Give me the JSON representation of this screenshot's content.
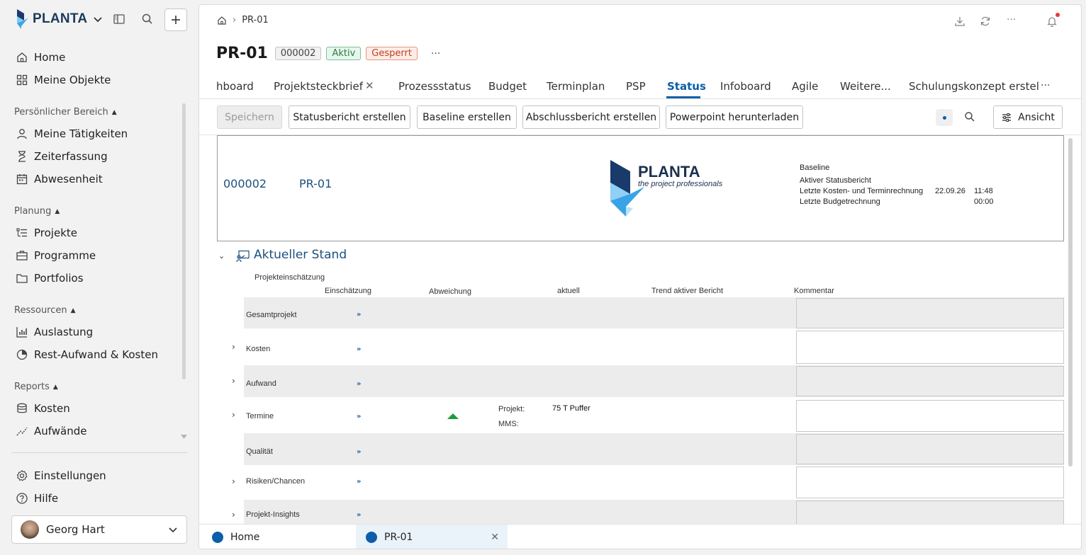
{
  "brand": {
    "name": "PLANTA"
  },
  "sidebar": {
    "top_items": [
      {
        "label": "Home",
        "icon": "home-icon"
      },
      {
        "label": "Meine Objekte",
        "icon": "grid-icon"
      }
    ],
    "sections": [
      {
        "title": "Persönlicher Bereich",
        "items": [
          {
            "label": "Meine Tätigkeiten",
            "icon": "user-icon"
          },
          {
            "label": "Zeiterfassung",
            "icon": "hourglass-icon"
          },
          {
            "label": "Abwesenheit",
            "icon": "calendar-icon"
          }
        ]
      },
      {
        "title": "Planung",
        "items": [
          {
            "label": "Projekte",
            "icon": "list-tree-icon"
          },
          {
            "label": "Programme",
            "icon": "briefcase-icon"
          },
          {
            "label": "Portfolios",
            "icon": "folder-icon"
          }
        ]
      },
      {
        "title": "Ressourcen",
        "items": [
          {
            "label": "Auslastung",
            "icon": "bar-chart-icon"
          },
          {
            "label": "Rest-Aufwand & Kosten",
            "icon": "pie-chart-icon"
          }
        ]
      },
      {
        "title": "Reports",
        "items": [
          {
            "label": "Kosten",
            "icon": "coins-icon"
          },
          {
            "label": "Aufwände",
            "icon": "trend-icon"
          }
        ]
      }
    ],
    "bottom_items": [
      {
        "label": "Einstellungen",
        "icon": "gear-icon"
      },
      {
        "label": "Hilfe",
        "icon": "help-icon"
      }
    ],
    "user": {
      "name": "Georg Hart"
    }
  },
  "breadcrumb": {
    "current": "PR-01"
  },
  "project": {
    "title": "PR-01",
    "id_badge": "000002",
    "status_badge_1": "Aktiv",
    "status_badge_2": "Gesperrt",
    "more": "···"
  },
  "tabs": [
    {
      "label": "hboard"
    },
    {
      "label": "Projektsteckbrief"
    },
    {
      "label": "Prozessstatus"
    },
    {
      "label": "Budget"
    },
    {
      "label": "Terminplan"
    },
    {
      "label": "PSP"
    },
    {
      "label": "Status",
      "active": true
    },
    {
      "label": "Infoboard"
    },
    {
      "label": "Agile"
    },
    {
      "label": "Weitere..."
    },
    {
      "label": "Schulungskonzept erstel"
    }
  ],
  "tabs_more": "···",
  "toolbar": {
    "save": "Speichern",
    "status_report": "Statusbericht erstellen",
    "baseline": "Baseline erstellen",
    "final_report": "Abschlussbericht erstellen",
    "powerpoint": "Powerpoint herunterladen",
    "view": "Ansicht"
  },
  "header_box": {
    "code": "000002",
    "name": "PR-01",
    "logo_text": "PLANTA",
    "logo_sub": "the project professionals",
    "baseline_label": "Baseline",
    "active_report_label": "Aktiver Statusbericht",
    "last_cost_label": "Letzte Kosten- und Terminrechnung",
    "last_cost_date": "22.09.26",
    "last_cost_time": "11:48",
    "last_budget_label": "Letzte Budgetrechnung",
    "last_budget_time": "00:00"
  },
  "section": {
    "title": "Aktueller Stand",
    "group_label": "Projekteinschätzung",
    "col_assessment": "Einschätzung",
    "col_deviation": "Abweichung",
    "col_current": "aktuell",
    "col_trend": "Trend aktiver Bericht",
    "col_comment": "Kommentar"
  },
  "rows": [
    {
      "label": "Gesamtprojekt",
      "arrow": "»"
    },
    {
      "label": "Kosten",
      "arrow": "»"
    },
    {
      "label": "Aufwand",
      "arrow": "»"
    },
    {
      "label": "Termine",
      "arrow": "»",
      "proj_label": "Projekt:",
      "proj_value": "75 T Puffer",
      "mms_label": "MMS:"
    },
    {
      "label": "Qualität",
      "arrow": "»"
    },
    {
      "label": "Risiken/Chancen",
      "arrow": "»"
    },
    {
      "label": "Projekt-Insights",
      "arrow": "»"
    }
  ],
  "bottom_tabs": [
    {
      "label": "Home"
    },
    {
      "label": "PR-01",
      "active": true
    }
  ],
  "colors": {
    "accent": "#0b5ea8",
    "brand_dark": "#1b3050",
    "status_up": "#1f9a3c"
  }
}
